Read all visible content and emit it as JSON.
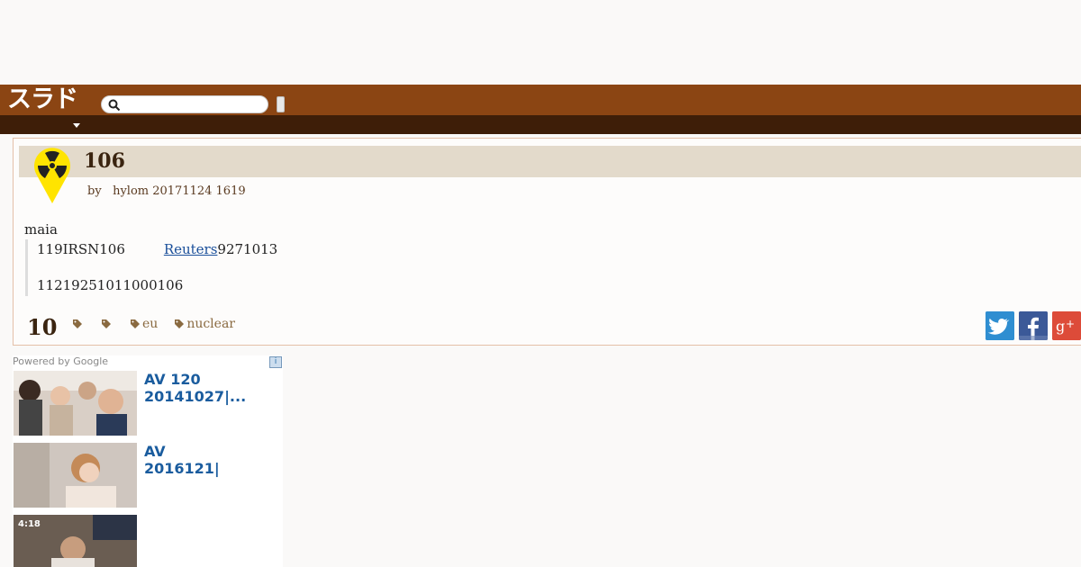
{
  "header": {
    "logo_text": "スラド",
    "search_placeholder": "",
    "search_value": ""
  },
  "article": {
    "title": "106",
    "byline_by": "by",
    "byline_author": "hylom 20171124 1619",
    "intro": "maia",
    "quote_prefix": "119IRSN106",
    "quote_link": "Reuters",
    "quote_suffix": "9271013",
    "quote_line2": "11219251011000106",
    "comment_count": "10",
    "tags": [
      "",
      "",
      "eu",
      "nuclear"
    ]
  },
  "ads": {
    "powered_by": "Powered by Google",
    "info_icon": "i",
    "items": [
      {
        "title_line1": "AV 120",
        "title_line2": "20141027|..."
      },
      {
        "title_line1": "AV",
        "title_line2": "2016121|"
      },
      {
        "duration": "4:18"
      }
    ]
  },
  "colors": {
    "header_brown": "#8b4513",
    "subbar_brown": "#3e1e08",
    "title_band": "#e3dacb",
    "twitter": "#2f8ed1",
    "facebook": "#3b5998",
    "google_plus": "#dd4b39"
  },
  "icons": {
    "search": "search-icon",
    "topic": "radiation-icon",
    "tag": "tag-icon",
    "twitter": "twitter-icon",
    "facebook": "facebook-icon",
    "google_plus": "google-plus-icon"
  }
}
